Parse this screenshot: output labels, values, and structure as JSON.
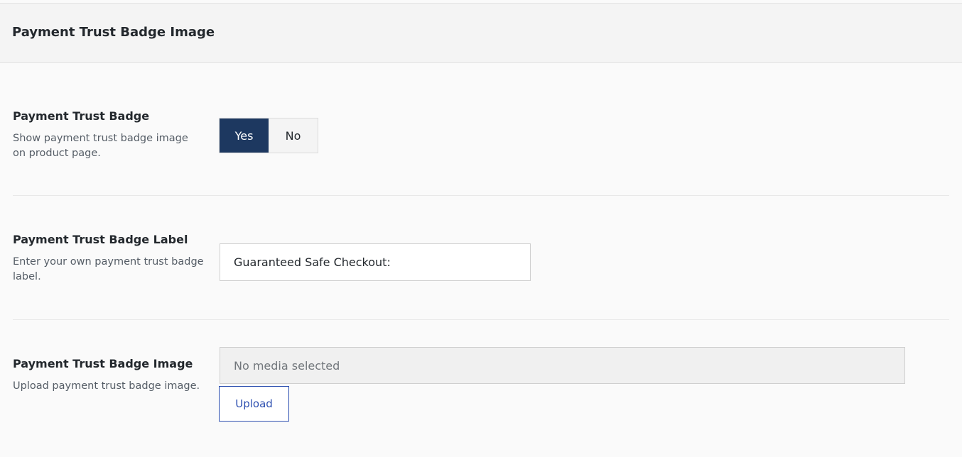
{
  "section": {
    "title": "Payment Trust Badge Image"
  },
  "fields": {
    "badge_toggle": {
      "label": "Payment Trust Badge",
      "description": "Show payment trust badge image on product page.",
      "options": [
        "Yes",
        "No"
      ],
      "selected": "Yes"
    },
    "badge_label": {
      "label": "Payment Trust Badge Label",
      "description": "Enter your own payment trust badge label.",
      "value": "Guaranteed Safe Checkout:"
    },
    "badge_image": {
      "label": "Payment Trust Badge Image",
      "description": "Upload payment trust badge image.",
      "media_status": "No media selected",
      "upload_label": "Upload"
    }
  },
  "colors": {
    "toggle_active_bg": "#1d3860",
    "upload_accent": "#2d4fb0"
  }
}
